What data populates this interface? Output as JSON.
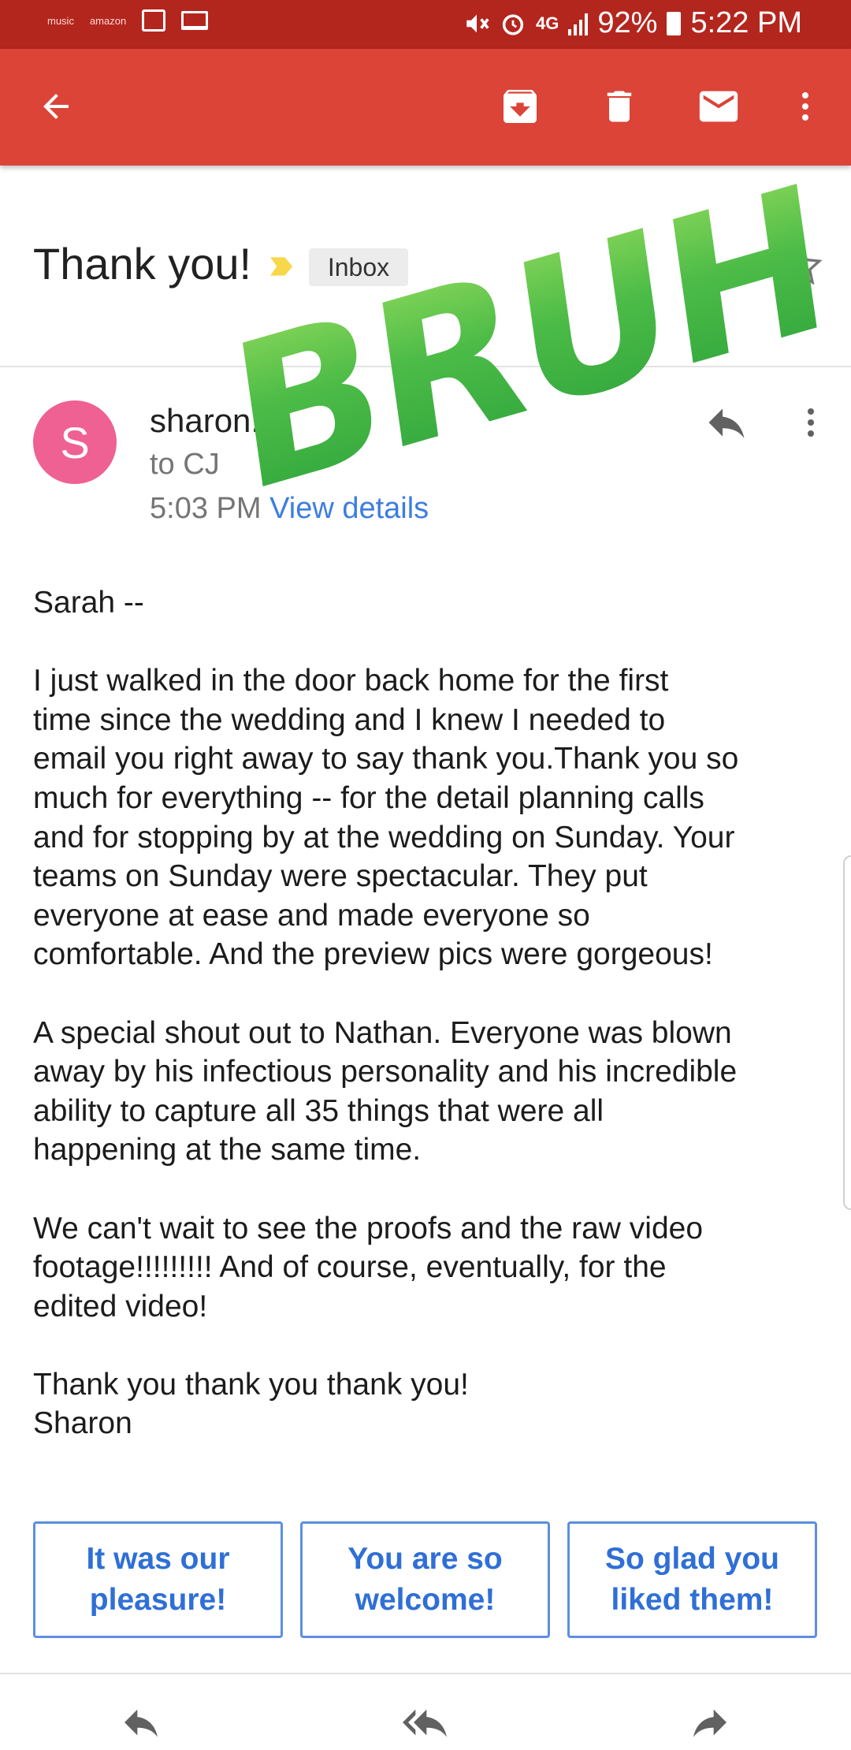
{
  "status_bar": {
    "left_icons": [
      "music",
      "amazon",
      "image-icon",
      "laptop-icon"
    ],
    "network": "4G",
    "battery": "92%",
    "time": "5:22 PM"
  },
  "app_bar": {
    "icons": [
      "back-arrow-icon",
      "archive-icon",
      "delete-icon",
      "mark-unread-icon",
      "more-vert-icon"
    ],
    "color": "#db4437"
  },
  "email": {
    "subject": "Thank you!",
    "label": "Inbox",
    "sender_initial": "S",
    "sender_name": "sharon.",
    "recipient": "to CJ",
    "time": "5:03 PM",
    "view_details": "View details",
    "body": [
      "Sarah --",
      "I just walked in the door back home for the first\ntime since the wedding and I knew I needed to\nemail you right away to say thank you.Thank you so\nmuch for everything -- for the detail planning calls\nand for stopping by at the wedding on Sunday. Your\nteams on Sunday were spectacular. They put\neveryone at ease and made everyone so\ncomfortable. And the preview pics were gorgeous!",
      "A special shout out to Nathan. Everyone was blown\naway by his infectious personality and his incredible\nability to capture all 35 things that were all\nhappening at the same time.",
      "We can't wait to see the proofs and the raw video\nfootage!!!!!!!!! And of course, eventually, for the\nedited video!",
      "Thank you thank you thank you!\nSharon"
    ]
  },
  "smart_replies": [
    "It was our\npleasure!",
    "You are so\nwelcome!",
    "So glad you\nliked them!"
  ],
  "bottom_actions": [
    "reply-icon",
    "reply-all-icon",
    "forward-icon"
  ],
  "overlay": {
    "text": "BRUH",
    "color": "#3fb34a"
  }
}
